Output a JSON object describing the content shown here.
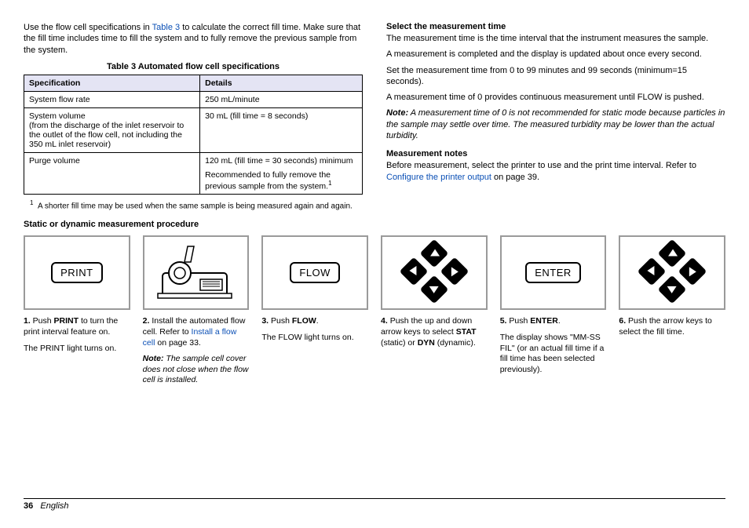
{
  "col1": {
    "intro_1a": "Use the flow cell specifications in ",
    "intro_link": "Table 3",
    "intro_1b": " to calculate the correct fill time. Make sure that the fill time includes time to fill the system and to fully remove the previous sample from the system.",
    "table_title": "Table 3  Automated flow cell specifications",
    "th_spec": "Specification",
    "th_details": "Details",
    "r1_spec": "System flow rate",
    "r1_det": "250 mL/minute",
    "r2_spec": "System volume\n(from the discharge of the inlet reservoir to the outlet of the flow cell, not including the 350 mL inlet reservoir)",
    "r2_det": "30 mL (fill time = 8 seconds)",
    "r3_spec": "Purge volume",
    "r3_det_a": "120 mL (fill time = 30 seconds) minimum",
    "r3_det_b": "Recommended to fully remove the previous sample from the system.",
    "footnote_marker": "1",
    "footnote": "A shorter fill time may be used when the same sample is being measured again and again.",
    "proc_heading": "Static or dynamic measurement procedure"
  },
  "col2": {
    "h1": "Select the measurement time",
    "p1": "The measurement time is the time interval that the instrument measures the sample.",
    "p2": "A measurement is completed and the display is updated about once every second.",
    "p3": "Set the measurement time from 0 to 99 minutes and 99 seconds (minimum=15 seconds).",
    "p4": "A measurement time of 0 provides continuous measurement until FLOW is pushed.",
    "note_label": "Note:",
    "note_body": " A measurement time of 0 is not recommended for static mode because particles in the sample may settle over time. The measured turbidity may be lower than the actual turbidity.",
    "h2": "Measurement notes",
    "p5a": "Before measurement, select the printer to use and the print time interval. Refer to ",
    "p5_link": "Configure the printer output",
    "p5b": " on page 39."
  },
  "steps": {
    "s1": {
      "btn": "PRINT",
      "num": "1.",
      "t1a": "  Push ",
      "t1b": "PRINT",
      "t1c": " to turn the print interval feature on.",
      "t2": "The PRINT light turns on."
    },
    "s2": {
      "num": "2.",
      "t1a": "  Install the automated flow cell. Refer to ",
      "t1_link": "Install a flow cell",
      "t1b": " on page 33.",
      "note_label": "Note:",
      "note_body": " The sample cell cover does not close when the flow cell is installed."
    },
    "s3": {
      "btn": "FLOW",
      "num": "3.",
      "t1a": "  Push ",
      "t1b": "FLOW",
      "t1c": ".",
      "t2": "The FLOW light turns on."
    },
    "s4": {
      "num": "4.",
      "t1a": "  Push the up and down arrow keys to select ",
      "t1b": "STAT",
      "t1c": " (static) or ",
      "t1d": "DYN",
      "t1e": " (dynamic)."
    },
    "s5": {
      "btn": "ENTER",
      "num": "5.",
      "t1a": "  Push ",
      "t1b": "ENTER",
      "t1c": ".",
      "t2": "The display shows \"MM-SS FIL\" (or an actual fill time if a fill time has been selected previously)."
    },
    "s6": {
      "num": "6.",
      "t1": "  Push the arrow keys to select the fill time."
    }
  },
  "footer": {
    "page": "36",
    "lang": "English"
  }
}
